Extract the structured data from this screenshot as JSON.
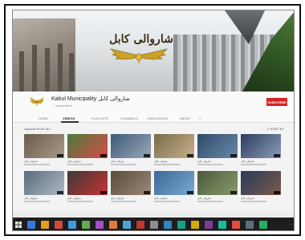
{
  "banner": {
    "title": "شاروالی کابل"
  },
  "channel": {
    "name": "Kabul Municipality شاروالی کابل",
    "subscribers": "… subscribers",
    "subscribe_label": "SUBSCRIBE"
  },
  "tabs": [
    "HOME",
    "VIDEOS",
    "PLAYLISTS",
    "CHANNELS",
    "DISCUSSION",
    "ABOUT"
  ],
  "active_tab": "VIDEOS",
  "section": {
    "title": "Uploads  PLAY ALL",
    "sort_label": "SORT BY"
  },
  "videos": [
    {
      "caption": "شاروالی کابل",
      "colors": [
        "#6b5a4a",
        "#a89a8a"
      ]
    },
    {
      "caption": "شاروالی کابل",
      "colors": [
        "#4a7a3a",
        "#d94a4a"
      ]
    },
    {
      "caption": "شاروالی کابل",
      "colors": [
        "#3d5a7a",
        "#9aa8b6"
      ]
    },
    {
      "caption": "شاروالی کابل",
      "colors": [
        "#7a6a4a",
        "#c6b28a"
      ]
    },
    {
      "caption": "شاروالی کابل",
      "colors": [
        "#2e4a6a",
        "#6a8aaa"
      ]
    },
    {
      "caption": "شاروالی کابل",
      "colors": [
        "#2c3c5c",
        "#8c9cbc"
      ]
    },
    {
      "caption": "شاروالی کابل",
      "colors": [
        "#5a6a7a",
        "#b0bac4"
      ]
    },
    {
      "caption": "شاروالی کابل",
      "colors": [
        "#3a3a3a",
        "#c83232"
      ]
    },
    {
      "caption": "شاروالی کابل",
      "colors": [
        "#5a4a3a",
        "#9a8a7a"
      ]
    },
    {
      "caption": "شاروالی کابل",
      "colors": [
        "#3a6a9a",
        "#7aa8d0"
      ]
    },
    {
      "caption": "شاروالی کابل",
      "colors": [
        "#4a5a3a",
        "#8a9a6a"
      ]
    },
    {
      "caption": "شاروالی کابل",
      "colors": [
        "#2a3a5a",
        "#7a5a4a"
      ]
    }
  ],
  "taskbar": {
    "icon_colors": [
      "#3b78d8",
      "#e0a020",
      "#d04a3a",
      "#3b9ae0",
      "#6aa84f",
      "#a64dc7",
      "#e07b39",
      "#4fa3d9",
      "#c0392b",
      "#8e8e8e",
      "#2e86c1",
      "#16a085",
      "#d4ac0d",
      "#7d3c98",
      "#1abc9c",
      "#e74c3c",
      "#5d6d7e",
      "#27ae60"
    ],
    "clock": "…"
  }
}
